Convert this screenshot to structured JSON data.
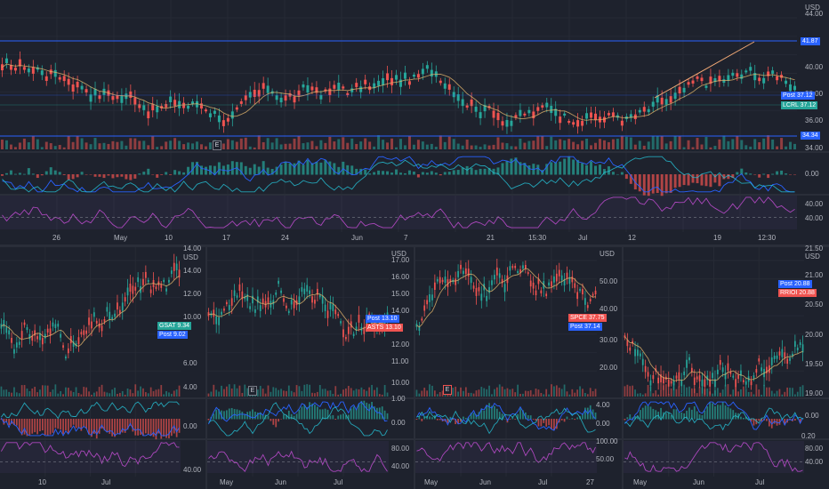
{
  "main": {
    "currency": "USD",
    "price_labels": [
      "44.00",
      "40.00",
      "38.00",
      "36.00",
      "34.00"
    ],
    "macd_label": "0.00",
    "rsi_label": "40.00",
    "hlines": [
      "41.87",
      "34.34"
    ],
    "tags": [
      {
        "text": "Post",
        "value": "37.12",
        "color": "#2962ff"
      },
      {
        "text": "LCRL",
        "value": "37.12",
        "color": "#26a69a"
      },
      {
        "text": "41.87",
        "value": "",
        "color": "#2962ff"
      },
      {
        "text": "34.34",
        "value": "",
        "color": "#2962ff"
      }
    ],
    "earnings_badge": "E",
    "time_labels": [
      "26",
      "May",
      "10",
      "17",
      "24",
      "Jun",
      "7",
      "21",
      "15:30",
      "Jul",
      "12",
      "19",
      "12:30"
    ]
  },
  "charts": [
    {
      "currency": "USD",
      "price_labels": [
        "14.00",
        "12.00",
        "10.00",
        "8.00",
        "6.00",
        "4.00"
      ],
      "top_label": "14.00",
      "macd_label": "0.00",
      "rsi_label": "40.00",
      "tags": [
        {
          "text": "GSAT",
          "value": "9.34",
          "color": "#26a69a"
        },
        {
          "text": "Post",
          "value": "9.02",
          "color": "#2962ff"
        }
      ],
      "time_labels": [
        "10",
        "Jul"
      ]
    },
    {
      "currency": "USD",
      "price_labels": [
        "17.00",
        "16.00",
        "15.00",
        "14.00",
        "13.00",
        "12.00",
        "11.00",
        "10.00"
      ],
      "macd_label": "0.00",
      "rsi_label": "40.00",
      "macd_top": "1.00",
      "rsi_top": "80.00",
      "tags": [
        {
          "text": "Post",
          "value": "13.10",
          "color": "#2962ff"
        },
        {
          "text": "ASTS",
          "value": "13.10",
          "color": "#ef5350"
        }
      ],
      "earnings_badge": "E",
      "time_labels": [
        "May",
        "Jun",
        "Jul"
      ]
    },
    {
      "currency": "USD",
      "price_labels": [
        "50.00",
        "40.00",
        "30.00",
        "20.00"
      ],
      "macd_label": "0.00",
      "rsi_label": "50.00",
      "macd_top": "4.00",
      "rsi_top": "100.00",
      "tags": [
        {
          "text": "SPCE",
          "value": "37.75",
          "color": "#ef5350"
        },
        {
          "text": "Post",
          "value": "37.14",
          "color": "#2962ff"
        }
      ],
      "earnings_badge": "E",
      "time_labels": [
        "May",
        "Jun",
        "Jul",
        "27"
      ]
    },
    {
      "currency": "USD",
      "price_labels": [
        "21.00",
        "20.50",
        "20.00",
        "19.50",
        "19.00"
      ],
      "top_label": "21.50",
      "macd_label": "0.00",
      "rsi_label": "40.00",
      "macd_top": "0.20",
      "rsi_top": "80.00",
      "tags": [
        {
          "text": "Post",
          "value": "20.88",
          "color": "#2962ff"
        },
        {
          "text": "RRIOI",
          "value": "20.88",
          "color": "#ef5350"
        }
      ],
      "time_labels": [
        "May",
        "Jun",
        "Jul"
      ]
    }
  ]
}
